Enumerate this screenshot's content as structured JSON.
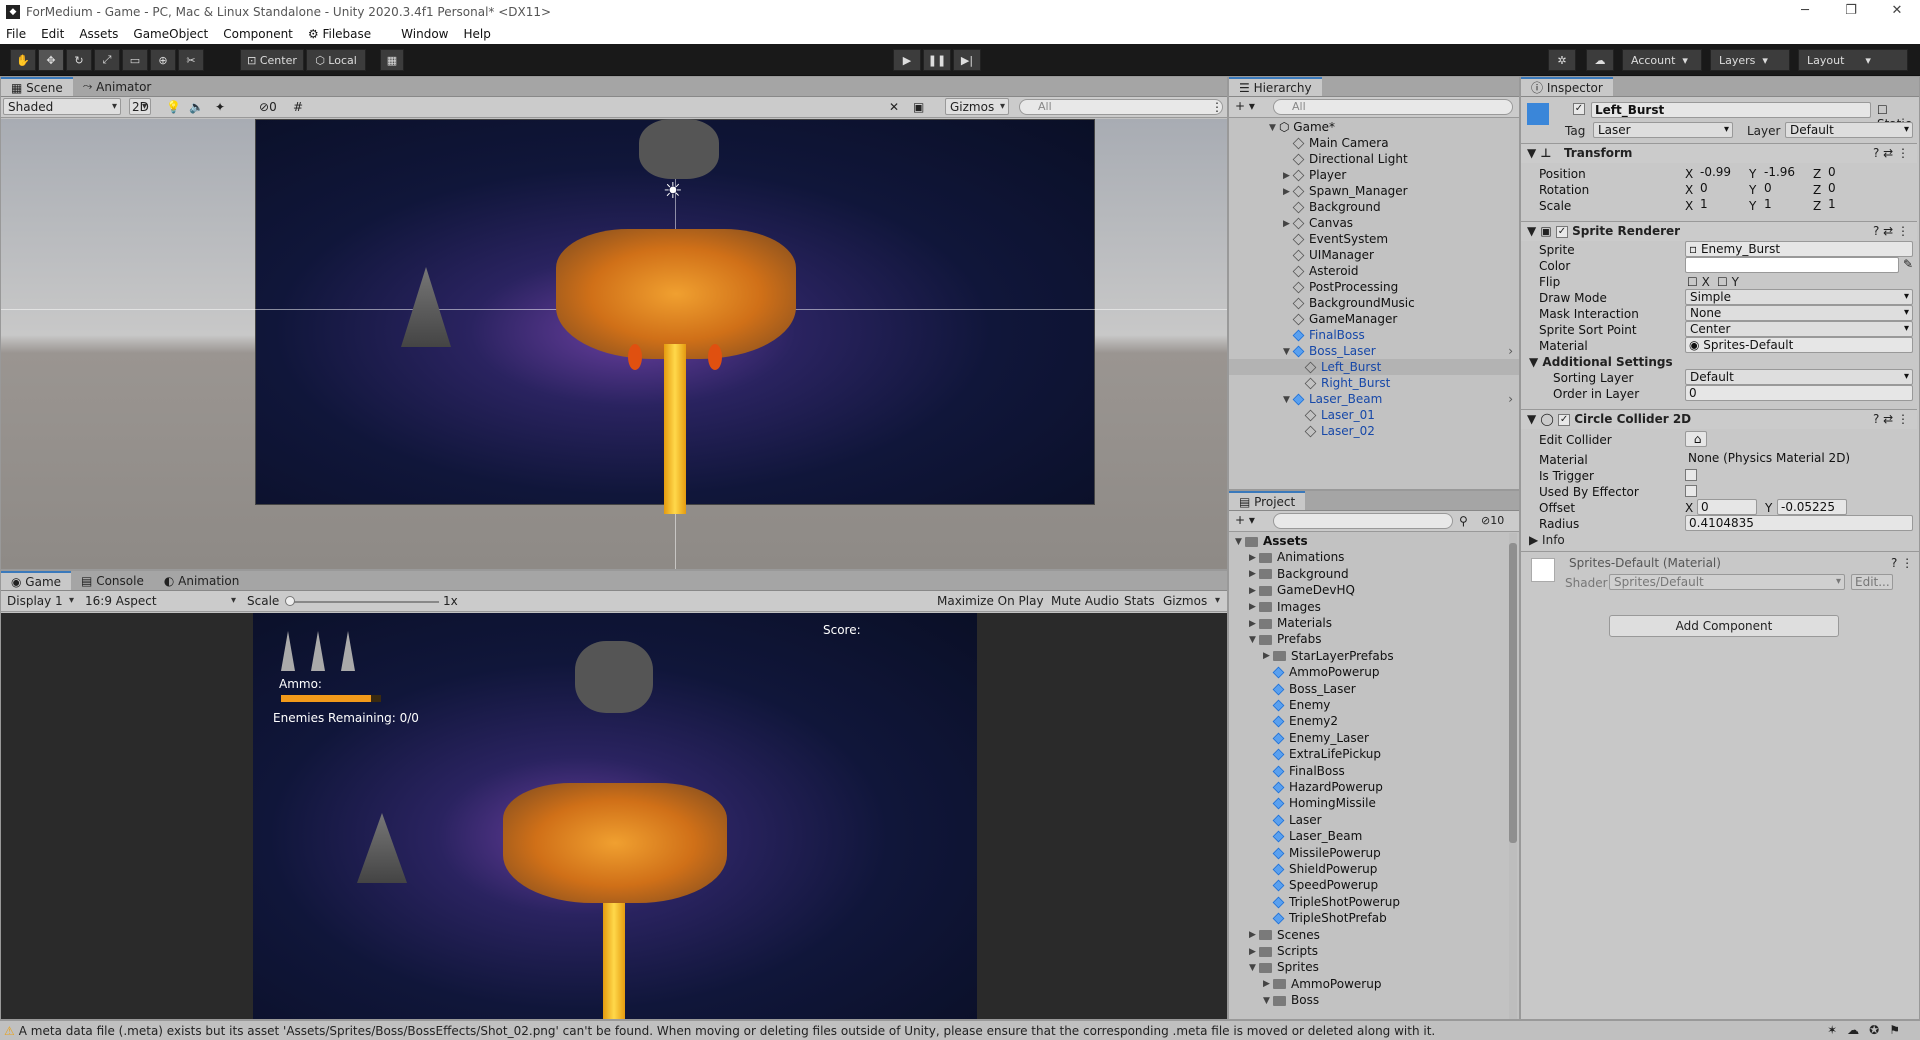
{
  "window": {
    "title": "ForMedium - Game - PC, Mac & Linux Standalone - Unity 2020.3.4f1 Personal* <DX11>",
    "icon": "unity-icon"
  },
  "menu": [
    "File",
    "Edit",
    "Assets",
    "GameObject",
    "Component",
    "Filebase",
    "Window",
    "Help"
  ],
  "toolbar": {
    "pivot": "Center",
    "space": "Local",
    "account": "Account",
    "layers": "Layers",
    "layout": "Layout"
  },
  "scene": {
    "tabs": [
      "Scene",
      "Animator"
    ],
    "shading": "Shaded",
    "mode2d": "2D",
    "gizmos": "Gizmos",
    "search_placeholder": "All",
    "hidden_count": "0"
  },
  "game": {
    "tabs": [
      "Game",
      "Console",
      "Animation"
    ],
    "display": "Display 1",
    "aspect": "16:9 Aspect",
    "scale_label": "Scale",
    "scale_value": "1x",
    "buttons": [
      "Maximize On Play",
      "Mute Audio",
      "Stats",
      "Gizmos"
    ],
    "hud": {
      "score": "Score:",
      "ammo": "Ammo:",
      "ammo_level": 0.9,
      "enemies": "Enemies Remaining: 0/0"
    }
  },
  "hierarchy": {
    "title": "Hierarchy",
    "search_placeholder": "All",
    "root": "Game*",
    "items": [
      {
        "label": "Main Camera",
        "depth": 1,
        "arrow": false,
        "prefab": false
      },
      {
        "label": "Directional Light",
        "depth": 1,
        "arrow": false,
        "prefab": false
      },
      {
        "label": "Player",
        "depth": 1,
        "arrow": true,
        "prefab": false
      },
      {
        "label": "Spawn_Manager",
        "depth": 1,
        "arrow": true,
        "prefab": false
      },
      {
        "label": "Background",
        "depth": 1,
        "arrow": false,
        "prefab": false
      },
      {
        "label": "Canvas",
        "depth": 1,
        "arrow": true,
        "prefab": false
      },
      {
        "label": "EventSystem",
        "depth": 1,
        "arrow": false,
        "prefab": false
      },
      {
        "label": "UIManager",
        "depth": 1,
        "arrow": false,
        "prefab": false
      },
      {
        "label": "Asteroid",
        "depth": 1,
        "arrow": false,
        "prefab": false
      },
      {
        "label": "PostProcessing",
        "depth": 1,
        "arrow": false,
        "prefab": false
      },
      {
        "label": "BackgroundMusic",
        "depth": 1,
        "arrow": false,
        "prefab": false
      },
      {
        "label": "GameManager",
        "depth": 1,
        "arrow": false,
        "prefab": false
      },
      {
        "label": "FinalBoss",
        "depth": 1,
        "arrow": false,
        "prefab": true
      },
      {
        "label": "Boss_Laser",
        "depth": 1,
        "arrow": true,
        "prefab": true
      },
      {
        "label": "Left_Burst",
        "depth": 2,
        "arrow": false,
        "prefab": true,
        "selected": true
      },
      {
        "label": "Right_Burst",
        "depth": 2,
        "arrow": false,
        "prefab": true
      },
      {
        "label": "Laser_Beam",
        "depth": 1,
        "arrow": true,
        "prefab": true
      },
      {
        "label": "Laser_01",
        "depth": 2,
        "arrow": false,
        "prefab": true
      },
      {
        "label": "Laser_02",
        "depth": 2,
        "arrow": false,
        "prefab": true
      }
    ]
  },
  "project": {
    "title": "Project",
    "hidden_count": "10",
    "items": [
      {
        "label": "Assets",
        "depth": 0,
        "type": "folder",
        "open": true,
        "bold": true
      },
      {
        "label": "Animations",
        "depth": 1,
        "type": "folder"
      },
      {
        "label": "Background",
        "depth": 1,
        "type": "folder"
      },
      {
        "label": "GameDevHQ",
        "depth": 1,
        "type": "folder"
      },
      {
        "label": "Images",
        "depth": 1,
        "type": "folder"
      },
      {
        "label": "Materials",
        "depth": 1,
        "type": "folder"
      },
      {
        "label": "Prefabs",
        "depth": 1,
        "type": "folder",
        "open": true
      },
      {
        "label": "StarLayerPrefabs",
        "depth": 2,
        "type": "folder"
      },
      {
        "label": "AmmoPowerup",
        "depth": 2,
        "type": "prefab"
      },
      {
        "label": "Boss_Laser",
        "depth": 2,
        "type": "prefab"
      },
      {
        "label": "Enemy",
        "depth": 2,
        "type": "prefab"
      },
      {
        "label": "Enemy2",
        "depth": 2,
        "type": "prefab"
      },
      {
        "label": "Enemy_Laser",
        "depth": 2,
        "type": "prefab"
      },
      {
        "label": "ExtraLifePickup",
        "depth": 2,
        "type": "prefab"
      },
      {
        "label": "FinalBoss",
        "depth": 2,
        "type": "prefab"
      },
      {
        "label": "HazardPowerup",
        "depth": 2,
        "type": "prefab"
      },
      {
        "label": "HomingMissile",
        "depth": 2,
        "type": "prefab"
      },
      {
        "label": "Laser",
        "depth": 2,
        "type": "prefab"
      },
      {
        "label": "Laser_Beam",
        "depth": 2,
        "type": "prefab"
      },
      {
        "label": "MissilePowerup",
        "depth": 2,
        "type": "prefab"
      },
      {
        "label": "ShieldPowerup",
        "depth": 2,
        "type": "prefab"
      },
      {
        "label": "SpeedPowerup",
        "depth": 2,
        "type": "prefab"
      },
      {
        "label": "TripleShotPowerup",
        "depth": 2,
        "type": "prefab"
      },
      {
        "label": "TripleShotPrefab",
        "depth": 2,
        "type": "prefab"
      },
      {
        "label": "Scenes",
        "depth": 1,
        "type": "folder"
      },
      {
        "label": "Scripts",
        "depth": 1,
        "type": "folder"
      },
      {
        "label": "Sprites",
        "depth": 1,
        "type": "folder",
        "open": true
      },
      {
        "label": "AmmoPowerup",
        "depth": 2,
        "type": "folder"
      },
      {
        "label": "Boss",
        "depth": 2,
        "type": "folder",
        "open": true
      }
    ]
  },
  "inspector": {
    "title": "Inspector",
    "object_name": "Left_Burst",
    "static": "Static",
    "tag_label": "Tag",
    "tag": "Laser",
    "layer_label": "Layer",
    "layer": "Default",
    "transform": {
      "title": "Transform",
      "position_label": "Position",
      "rotation_label": "Rotation",
      "scale_label": "Scale",
      "position": [
        "-0.99",
        "-1.96",
        "0"
      ],
      "rotation": [
        "0",
        "0",
        "0"
      ],
      "scale": [
        "1",
        "1",
        "1"
      ]
    },
    "sprite_renderer": {
      "title": "Sprite Renderer",
      "sprite_label": "Sprite",
      "sprite": "Enemy_Burst",
      "color_label": "Color",
      "flip_label": "Flip",
      "draw_mode_label": "Draw Mode",
      "draw_mode": "Simple",
      "mask_label": "Mask Interaction",
      "mask": "None",
      "sort_point_label": "Sprite Sort Point",
      "sort_point": "Center",
      "material_label": "Material",
      "material": "Sprites-Default",
      "additional": "Additional Settings",
      "sorting_layer_label": "Sorting Layer",
      "sorting_layer": "Default",
      "order_label": "Order in Layer",
      "order": "0"
    },
    "circle_collider": {
      "title": "Circle Collider 2D",
      "edit_label": "Edit Collider",
      "material_label": "Material",
      "material": "None (Physics Material 2D)",
      "trigger_label": "Is Trigger",
      "effector_label": "Used By Effector",
      "offset_label": "Offset",
      "offset": [
        "0",
        "-0.05225"
      ],
      "radius_label": "Radius",
      "radius": "0.4104835",
      "info": "Info"
    },
    "material": {
      "name": "Sprites-Default (Material)",
      "shader_label": "Shader",
      "shader": "Sprites/Default",
      "edit": "Edit..."
    },
    "add_component": "Add Component"
  },
  "status": {
    "message": "A meta data file (.meta) exists but its asset 'Assets/Sprites/Boss/BossEffects/Shot_02.png' can't be found. When moving or deleting files outside of Unity, please ensure that the corresponding .meta file is moved or deleted along with it."
  },
  "colors": {
    "accent": "#3a79bb",
    "prefab_blue": "#1748a8",
    "warning": "#e8a21b"
  }
}
